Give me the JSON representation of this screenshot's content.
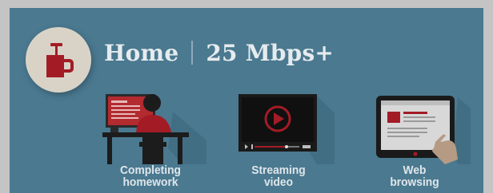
{
  "header": {
    "title": "Home",
    "speed": "25 Mbps+"
  },
  "logo": {
    "icon": "mug-icon"
  },
  "activities": [
    {
      "line1": "Completing",
      "line2": "homework",
      "icon": "student-at-computer-icon"
    },
    {
      "line1": "Streaming",
      "line2": "video",
      "icon": "video-player-icon"
    },
    {
      "line1": "Web",
      "line2": "browsing",
      "icon": "tablet-browsing-icon"
    }
  ],
  "colors": {
    "panel": "#4a7990",
    "accent_red": "#a31c25",
    "logo_bg": "#d9d3c7",
    "label_text": "#dfe6ea"
  }
}
